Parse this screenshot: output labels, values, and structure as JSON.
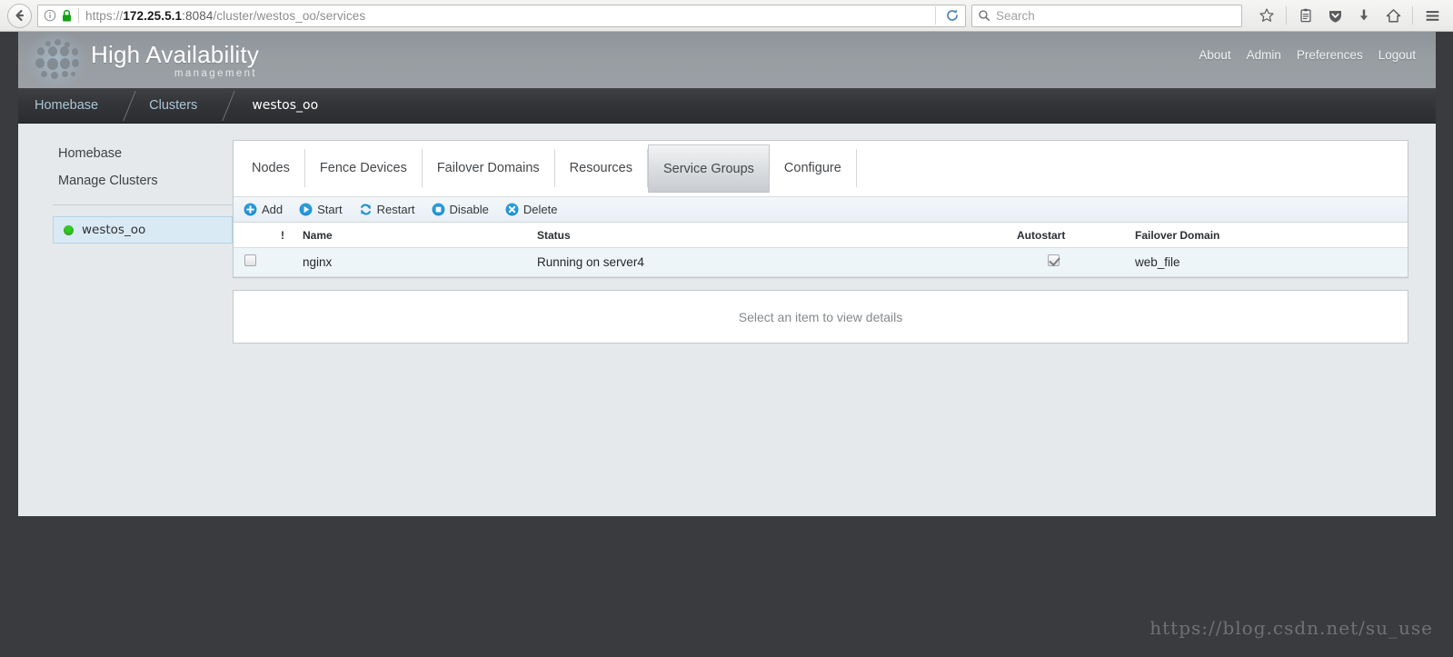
{
  "browser": {
    "back_icon": "back-arrow-icon",
    "info_icon": "info-icon",
    "lock_icon": "lock-icon",
    "url_scheme": "https://",
    "url_host": "172.25.5.1",
    "url_port": ":8084",
    "url_path": "/cluster/westos_oo/services",
    "url_full": "https://172.25.5.1:8084/cluster/westos_oo/services",
    "reload_icon": "reload-icon",
    "search_placeholder": "Search",
    "search_icon": "search-icon",
    "toolbar_icons": [
      "star-icon",
      "library-icon",
      "shield-icon",
      "download-icon",
      "home-icon",
      "menu-icon"
    ]
  },
  "header": {
    "brand_title": "High Availability",
    "brand_subtitle": "management",
    "logo_icon": "cluster-dots-logo",
    "nav": [
      {
        "label": "About"
      },
      {
        "label": "Admin"
      },
      {
        "label": "Preferences"
      },
      {
        "label": "Logout"
      }
    ]
  },
  "breadcrumb": [
    {
      "label": "Homebase",
      "current": false
    },
    {
      "label": "Clusters",
      "current": false
    },
    {
      "label": "westos_oo",
      "current": true
    }
  ],
  "sidebar": {
    "links": [
      {
        "label": "Homebase"
      },
      {
        "label": "Manage Clusters"
      }
    ],
    "clusters": [
      {
        "label": "westos_oo",
        "status_color": "#36c923",
        "selected": true
      }
    ]
  },
  "tabs": [
    {
      "label": "Nodes",
      "active": false
    },
    {
      "label": "Fence Devices",
      "active": false
    },
    {
      "label": "Failover Domains",
      "active": false
    },
    {
      "label": "Resources",
      "active": false
    },
    {
      "label": "Service Groups",
      "active": true
    },
    {
      "label": "Configure",
      "active": false
    }
  ],
  "toolbar": {
    "add_label": "Add",
    "start_label": "Start",
    "restart_label": "Restart",
    "disable_label": "Disable",
    "delete_label": "Delete",
    "accent_color": "#1a8fd1"
  },
  "table": {
    "headers": {
      "bang": "!",
      "name": "Name",
      "status": "Status",
      "autostart": "Autostart",
      "failover": "Failover Domain"
    },
    "rows": [
      {
        "selected": false,
        "bang": "",
        "name": "nginx",
        "status": "Running on server4",
        "autostart": true,
        "failover_domain": "web_file"
      }
    ]
  },
  "details": {
    "empty_message": "Select an item to view details"
  },
  "watermark": {
    "text": "https://blog.csdn.net/su_use"
  }
}
